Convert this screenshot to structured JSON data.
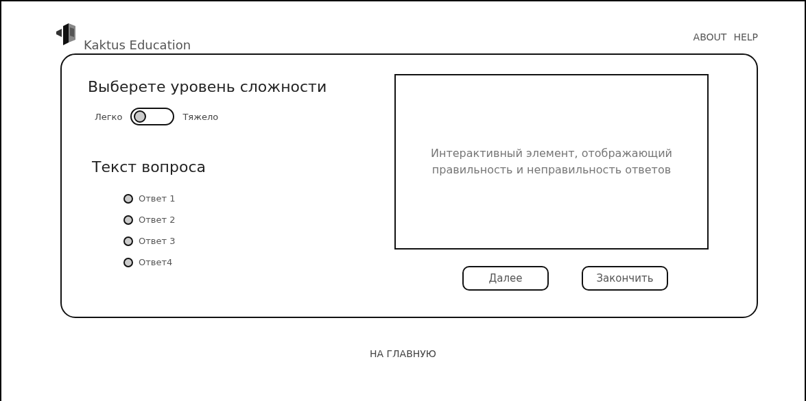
{
  "header": {
    "brand": "Kaktus Education",
    "nav": [
      "ABOUT",
      "HELP"
    ]
  },
  "difficulty": {
    "title": "Выберете уровень сложности",
    "left_label": "Легко",
    "right_label": "Тяжело",
    "on": false
  },
  "question": {
    "text": "Текст вопроса",
    "answers": [
      {
        "label": "Ответ 1",
        "selected": false
      },
      {
        "label": "Ответ 2",
        "selected": false
      },
      {
        "label": "Ответ 3",
        "selected": false
      },
      {
        "label": "Ответ4",
        "selected": false
      }
    ]
  },
  "feedback": {
    "text": "Интерактивный элемент, отображающий правильность и неправильность ответов"
  },
  "buttons": [
    "Далее",
    "Закончить"
  ],
  "footer": {
    "link": "НА ГЛАВНУЮ"
  }
}
